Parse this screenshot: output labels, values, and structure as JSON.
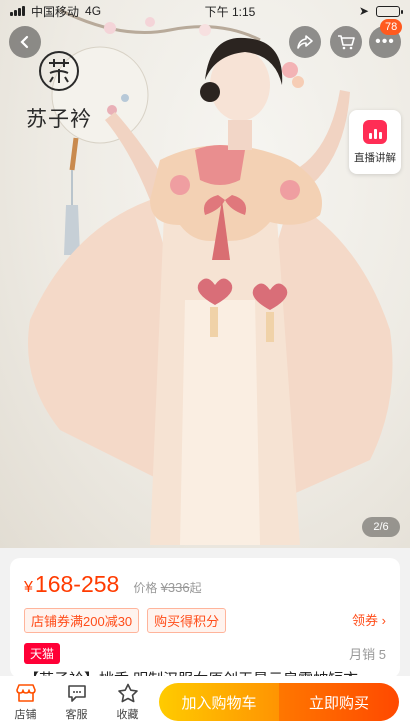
{
  "status_bar": {
    "carrier": "中国移动",
    "network": "4G",
    "time": "下午 1:15",
    "battery_level": 0.9
  },
  "header": {
    "cart_badge": "78"
  },
  "hero": {
    "brand_name": "苏子衿",
    "live_label": "直播讲解",
    "pager": "2/6"
  },
  "price_card": {
    "currency": "¥",
    "price_range": "168-258",
    "orig_label": "价格",
    "orig_price": "¥336",
    "orig_suffix": "起",
    "coupons": [
      "店铺券满200减30",
      "购买得积分"
    ],
    "get_coupon": "领券",
    "platform_tag": "天猫",
    "monthly_sales": "月销 5",
    "title_partial": "【苏子衿】桃香 明制汉服女原创无是云肩霞帔短衣"
  },
  "bottom_bar": {
    "shop": "店铺",
    "service": "客服",
    "favorite": "收藏",
    "add_to_cart": "加入购物车",
    "buy_now": "立即购买"
  },
  "colors": {
    "accent": "#ff3b00",
    "cart_button": "#ffa300",
    "buy_button": "#ff5500",
    "tmall_red": "#ff0036"
  }
}
